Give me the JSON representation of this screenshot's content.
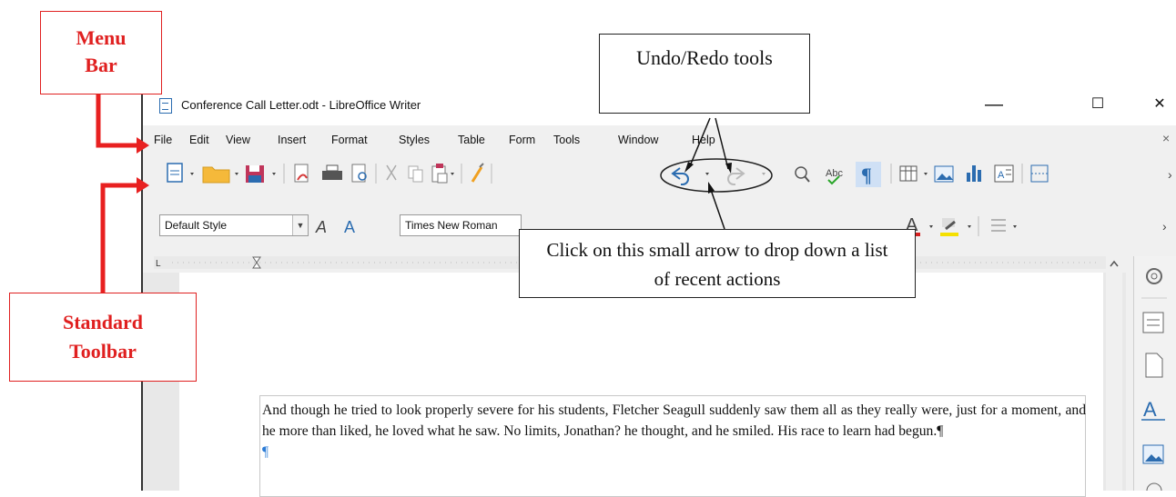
{
  "window": {
    "title": "Conference Call Letter.odt - LibreOffice Writer",
    "controls": {
      "minimize": "—",
      "maximize": "☐",
      "close": "✕"
    }
  },
  "menubar": {
    "items": [
      "File",
      "Edit",
      "View",
      "Insert",
      "Format",
      "Styles",
      "Table",
      "Form",
      "Tools",
      "Window",
      "Help"
    ],
    "close": "×"
  },
  "formatting": {
    "paragraph_style": "Default Style",
    "font_name": "Times New Roman"
  },
  "document": {
    "text": "And though he tried to look properly severe for his students, Fletcher Seagull suddenly saw them all as they really were, just for a moment, and he more than liked, he loved what he saw. No limits, Jonathan? he thought, and he smiled. His race to learn had begun.¶",
    "empty_paragraph": "¶"
  },
  "callouts": {
    "menu_bar": "Menu Bar",
    "standard_toolbar": "Standard Toolbar",
    "undo_redo": "Undo/Redo tools",
    "arrow_note": "Click on this small arrow to drop down a list of recent actions"
  },
  "colors": {
    "callout_red": "#e02020",
    "accent_blue": "#2b6cb0",
    "paragraph_mark_blue": "#2b7bd6"
  }
}
